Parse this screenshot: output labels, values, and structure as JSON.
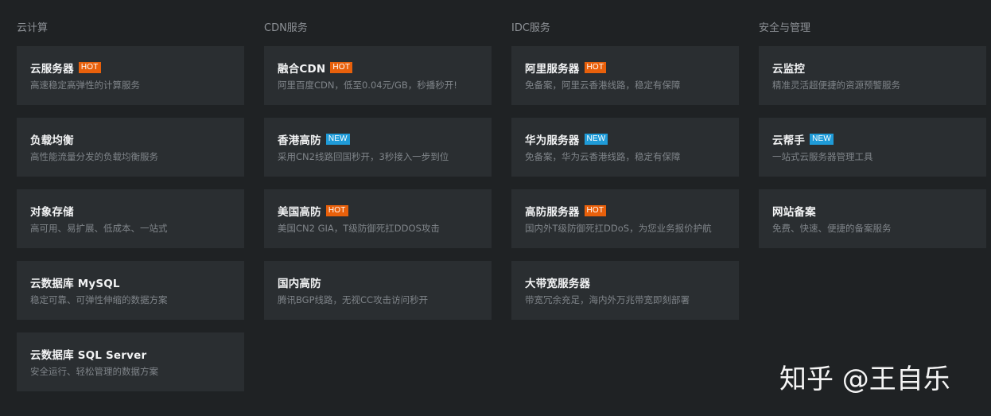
{
  "colors": {
    "background": "#1f2224",
    "card": "#2a2e31",
    "hot": "#e8600b",
    "new": "#1f9bd8"
  },
  "columns": [
    {
      "title": "云计算",
      "items": [
        {
          "title": "云服务器",
          "badge": "HOT",
          "desc": "高速稳定高弹性的计算服务"
        },
        {
          "title": "负载均衡",
          "badge": "",
          "desc": "高性能流量分发的负载均衡服务"
        },
        {
          "title": "对象存储",
          "badge": "",
          "desc": "高可用、易扩展、低成本、一站式"
        },
        {
          "title": "云数据库 MySQL",
          "badge": "",
          "desc": "稳定可靠、可弹性伸缩的数据方案"
        },
        {
          "title": "云数据库 SQL Server",
          "badge": "",
          "desc": "安全运行、轻松管理的数据方案"
        }
      ]
    },
    {
      "title": "CDN服务",
      "items": [
        {
          "title": "融合CDN",
          "badge": "HOT",
          "desc": "阿里百度CDN，低至0.04元/GB，秒播秒开!"
        },
        {
          "title": "香港高防",
          "badge": "NEW",
          "desc": "采用CN2线路回国秒开，3秒接入一步到位"
        },
        {
          "title": "美国高防",
          "badge": "HOT",
          "desc": "美国CN2 GIA，T级防御死扛DDOS攻击"
        },
        {
          "title": "国内高防",
          "badge": "",
          "desc": "腾讯BGP线路，无视CC攻击访问秒开"
        }
      ]
    },
    {
      "title": "IDC服务",
      "items": [
        {
          "title": "阿里服务器",
          "badge": "HOT",
          "desc": "免备案，阿里云香港线路，稳定有保障"
        },
        {
          "title": "华为服务器",
          "badge": "NEW",
          "desc": "免备案，华为云香港线路，稳定有保障"
        },
        {
          "title": "高防服务器",
          "badge": "HOT",
          "desc": "国内外T级防御死扛DDoS，为您业务报价护航"
        },
        {
          "title": "大带宽服务器",
          "badge": "",
          "desc": "带宽冗余充足，海内外万兆带宽即刻部署"
        }
      ]
    },
    {
      "title": "安全与管理",
      "items": [
        {
          "title": "云监控",
          "badge": "",
          "desc": "精准灵活超便捷的资源预警服务"
        },
        {
          "title": "云帮手",
          "badge": "NEW",
          "desc": "一站式云服务器管理工具"
        },
        {
          "title": "网站备案",
          "badge": "",
          "desc": "免费、快速、便捷的备案服务"
        }
      ]
    }
  ],
  "watermark": "知乎 @王自乐"
}
